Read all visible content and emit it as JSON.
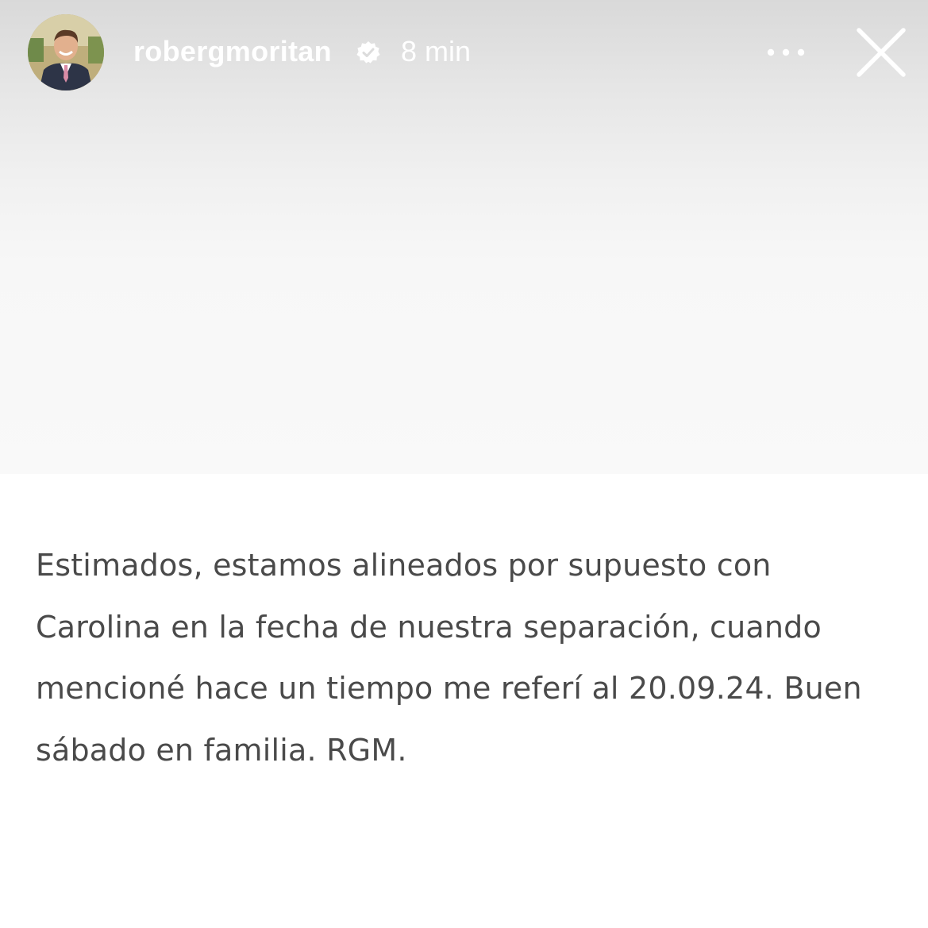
{
  "header": {
    "username": "robergmoritan",
    "timestamp": "8 min",
    "verified_icon": "verified-badge-icon",
    "more_icon": "more-horizontal-icon",
    "close_icon": "close-icon"
  },
  "post": {
    "lines": [
      "Estimados, estamos alineados por supuesto con",
      "Carolina en la fecha de nuestra separación, cuando",
      "mencioné hace un tiempo me referí al 20.09.24. Buen",
      "sábado en familia. RGM."
    ]
  },
  "colors": {
    "header_text": "#ffffff",
    "body_text": "#4a4a4a",
    "top_background": "#f9f9f9",
    "bottom_background": "#ffffff"
  }
}
